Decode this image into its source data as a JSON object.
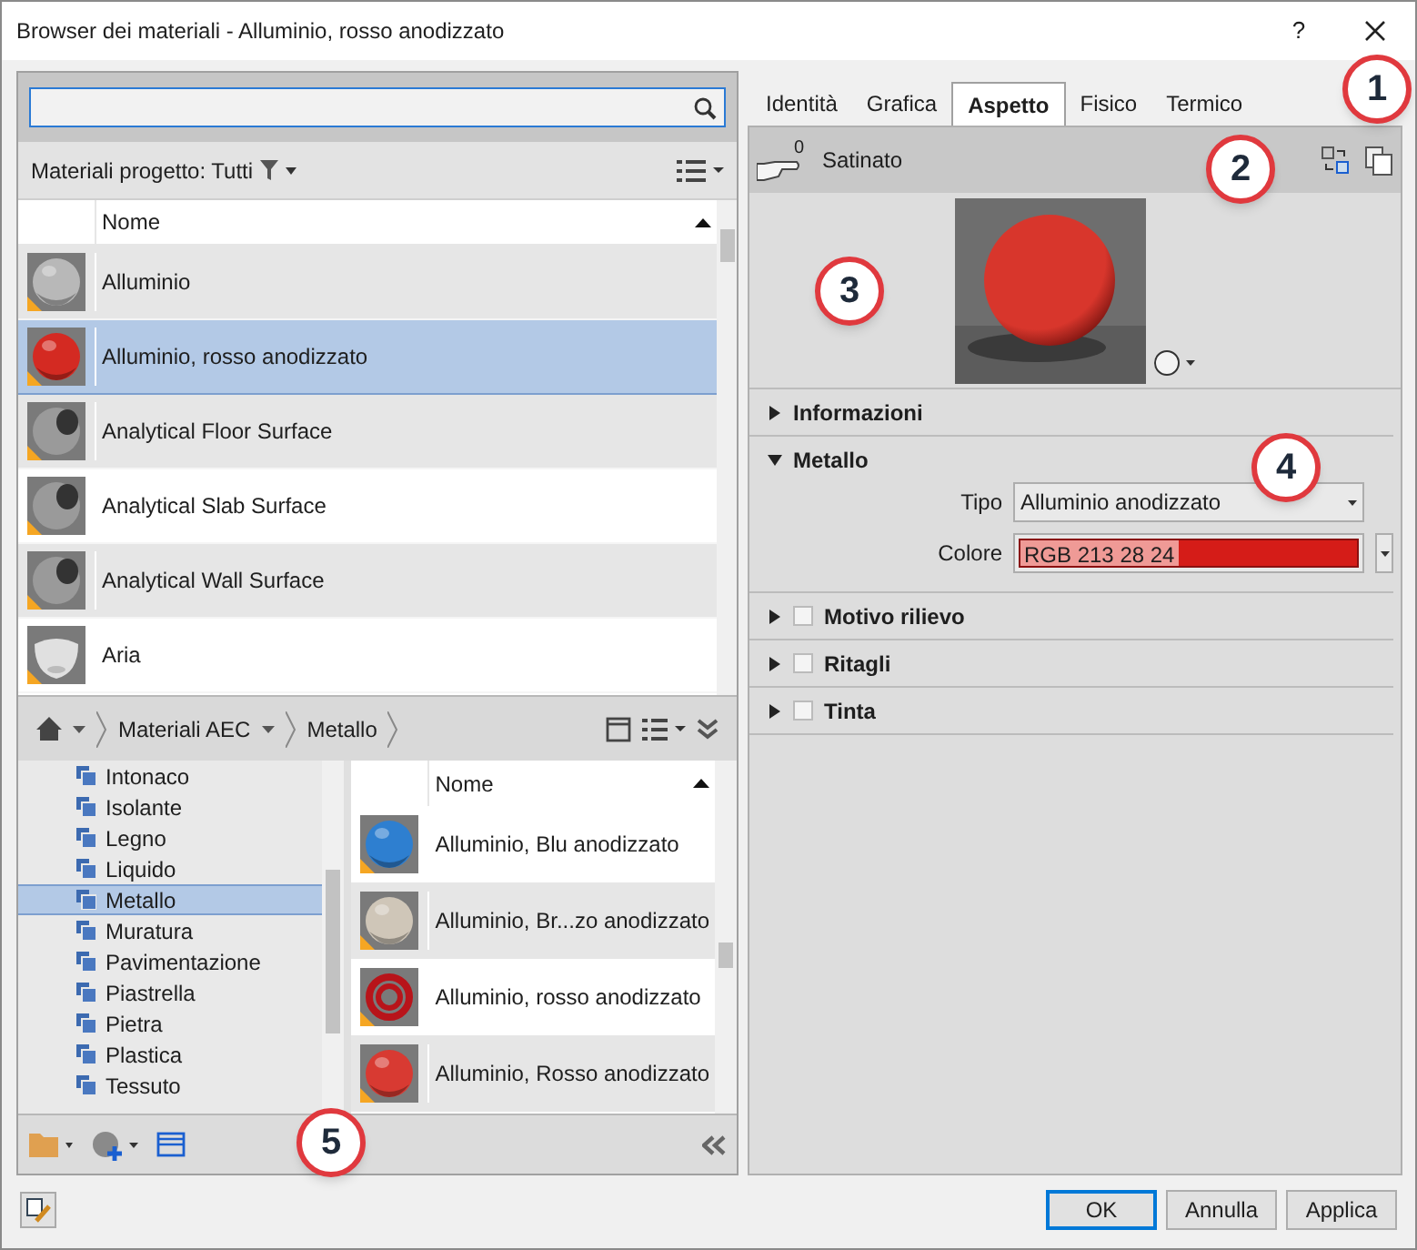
{
  "window": {
    "title": "Browser dei materiali - Alluminio, rosso anodizzato",
    "help": "?"
  },
  "filter": {
    "label": "Materiali progetto: Tutti"
  },
  "project_table": {
    "columns": [
      "Nome"
    ],
    "rows": [
      {
        "name": "Alluminio",
        "selected": false,
        "thumb": {
          "kind": "sphere",
          "color": "#b8b8b8"
        }
      },
      {
        "name": "Alluminio, rosso anodizzato",
        "selected": true,
        "thumb": {
          "kind": "sphere",
          "color": "#d42a22"
        }
      },
      {
        "name": "Analytical Floor Surface",
        "selected": false,
        "thumb": {
          "kind": "analytical",
          "color": "#9a9a9a"
        }
      },
      {
        "name": "Analytical Slab Surface",
        "selected": false,
        "thumb": {
          "kind": "analytical",
          "color": "#9a9a9a"
        }
      },
      {
        "name": "Analytical Wall Surface",
        "selected": false,
        "thumb": {
          "kind": "analytical",
          "color": "#9a9a9a"
        }
      },
      {
        "name": "Aria",
        "selected": false,
        "thumb": {
          "kind": "air",
          "color": "#e0e0e0"
        }
      }
    ]
  },
  "breadcrumb": [
    "Materiali AEC",
    "Metallo"
  ],
  "tree": [
    {
      "label": "Intonaco",
      "selected": false
    },
    {
      "label": "Isolante",
      "selected": false
    },
    {
      "label": "Legno",
      "selected": false
    },
    {
      "label": "Liquido",
      "selected": false
    },
    {
      "label": "Metallo",
      "selected": true
    },
    {
      "label": "Muratura",
      "selected": false
    },
    {
      "label": "Pavimentazione",
      "selected": false
    },
    {
      "label": "Piastrella",
      "selected": false
    },
    {
      "label": "Pietra",
      "selected": false
    },
    {
      "label": "Plastica",
      "selected": false
    },
    {
      "label": "Tessuto",
      "selected": false
    }
  ],
  "library_table": {
    "columns": [
      "Nome"
    ],
    "rows": [
      {
        "name": "Alluminio, Blu anodizzato",
        "thumb": {
          "kind": "sphere",
          "color": "#2e7fd0"
        }
      },
      {
        "name": "Alluminio, Br...zo anodizzato",
        "thumb": {
          "kind": "sphere",
          "color": "#cfc6b8"
        }
      },
      {
        "name": "Alluminio, rosso anodizzato",
        "thumb": {
          "kind": "torus",
          "color": "#b8141a"
        }
      },
      {
        "name": "Alluminio, Rosso anodizzato",
        "thumb": {
          "kind": "sphere",
          "color": "#d83a32"
        }
      }
    ]
  },
  "tabs": [
    {
      "label": "Identità",
      "selected": false
    },
    {
      "label": "Grafica",
      "selected": false
    },
    {
      "label": "Aspetto",
      "selected": true
    },
    {
      "label": "Fisico",
      "selected": false
    },
    {
      "label": "Termico",
      "selected": false
    }
  ],
  "asset": {
    "count": "0",
    "name": "Satinato"
  },
  "preview": {
    "color": "#d8362c"
  },
  "sections": [
    {
      "title": "Informazioni",
      "kind": "plain",
      "expanded": false
    },
    {
      "title": "Metallo",
      "kind": "plain",
      "expanded": true,
      "fields": [
        {
          "label": "Tipo",
          "kind": "select",
          "value": "Alluminio anodizzato"
        },
        {
          "label": "Colore",
          "kind": "color",
          "value": "RGB 213 28 24",
          "color": "#d51c18"
        }
      ]
    },
    {
      "title": "Motivo rilievo",
      "kind": "checkbox",
      "expanded": false,
      "checked": false
    },
    {
      "title": "Ritagli",
      "kind": "checkbox",
      "expanded": false,
      "checked": false
    },
    {
      "title": "Tinta",
      "kind": "checkbox",
      "expanded": false,
      "checked": false
    }
  ],
  "buttons": [
    {
      "label": "OK",
      "default": true
    },
    {
      "label": "Annulla",
      "default": false
    },
    {
      "label": "Applica",
      "default": false
    }
  ],
  "callouts": [
    "1",
    "2",
    "3",
    "4",
    "5"
  ]
}
